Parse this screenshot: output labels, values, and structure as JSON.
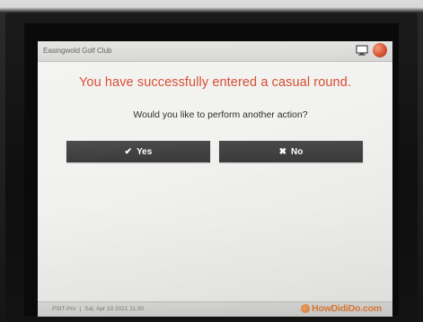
{
  "window": {
    "title": "Easingwold Golf Club"
  },
  "icons": {
    "screen": "monitor-icon",
    "power": "power-icon",
    "yes": "checkmark-icon",
    "no": "x-icon",
    "brand": "howdidido-logo-icon"
  },
  "dialog": {
    "message": "You have successfully entered a casual round.",
    "question": "Would you like to perform another action?",
    "yes_label": "Yes",
    "no_label": "No"
  },
  "footer": {
    "app": "PSIT-Pro",
    "datetime": "Sat, Apr 10 2021 11:30",
    "brand": "HowDidiDo.com"
  },
  "colors": {
    "message": "#d84a30",
    "button_bg": "#404040",
    "brand": "#e07a34"
  }
}
